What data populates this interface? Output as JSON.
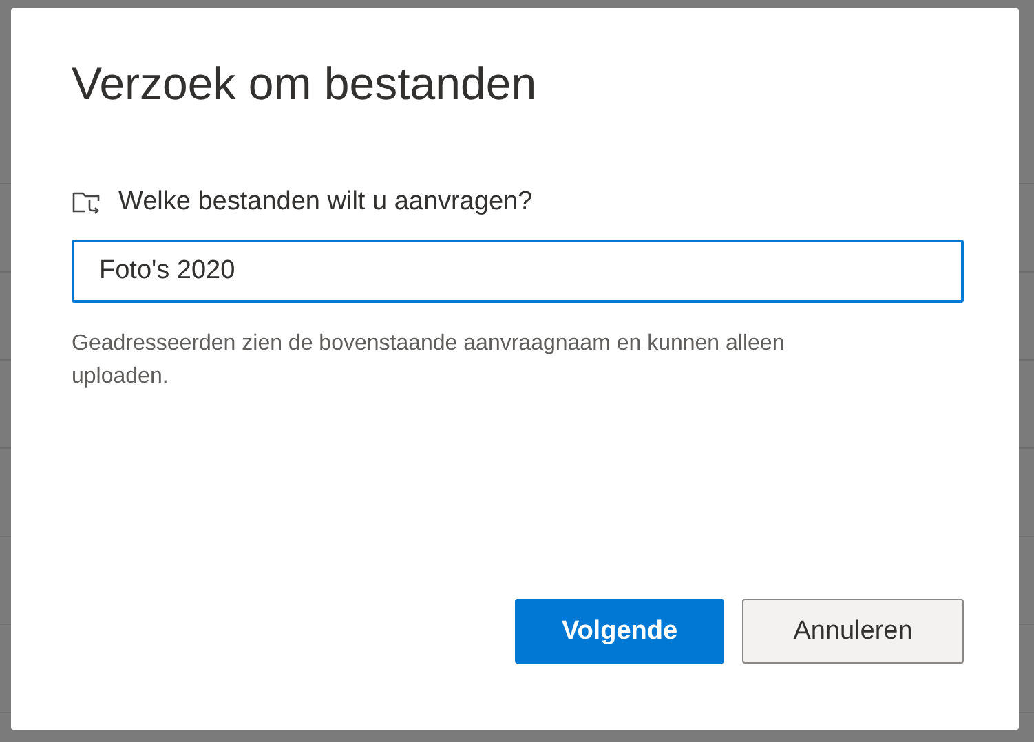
{
  "dialog": {
    "title": "Verzoek om bestanden",
    "question": "Welke bestanden wilt u aanvragen?",
    "input": {
      "value": "Foto's 2020"
    },
    "help": "Geadresseerden zien de bovenstaande aanvraagnaam en kunnen alleen uploaden.",
    "buttons": [
      {
        "label": "Volgende",
        "kind": "primary"
      },
      {
        "label": "Annuleren",
        "kind": "secondary"
      }
    ]
  }
}
